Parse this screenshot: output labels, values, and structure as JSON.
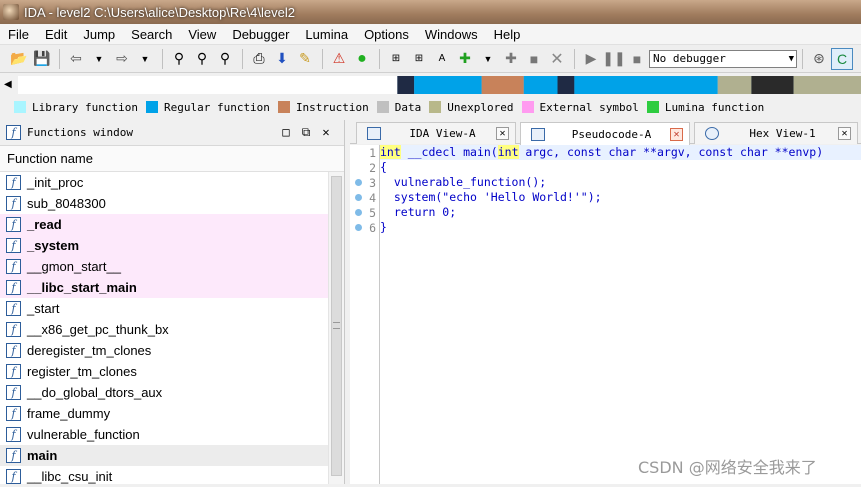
{
  "window": {
    "title": "IDA - level2 C:\\Users\\alice\\Desktop\\Re\\4\\level2"
  },
  "menu": [
    "File",
    "Edit",
    "Jump",
    "Search",
    "View",
    "Debugger",
    "Lumina",
    "Options",
    "Windows",
    "Help"
  ],
  "toolbar": {
    "debugger_select": "No debugger"
  },
  "navbar": {
    "segments": [
      {
        "from": 0.0,
        "to": 0.45,
        "color": "#ffffff"
      },
      {
        "from": 0.45,
        "to": 0.47,
        "color": "#1f2a44"
      },
      {
        "from": 0.47,
        "to": 0.55,
        "color": "#00a2e8"
      },
      {
        "from": 0.55,
        "to": 0.6,
        "color": "#c8825a"
      },
      {
        "from": 0.6,
        "to": 0.64,
        "color": "#00a2e8"
      },
      {
        "from": 0.64,
        "to": 0.66,
        "color": "#1f2a44"
      },
      {
        "from": 0.66,
        "to": 0.83,
        "color": "#00a2e8"
      },
      {
        "from": 0.83,
        "to": 0.87,
        "color": "#b0b090"
      },
      {
        "from": 0.87,
        "to": 0.92,
        "color": "#2a2a2a"
      },
      {
        "from": 0.92,
        "to": 1.0,
        "color": "#b0b090"
      }
    ]
  },
  "legend": [
    {
      "label": "Library function",
      "color": "#a9f5ff"
    },
    {
      "label": "Regular function",
      "color": "#00a2e8"
    },
    {
      "label": "Instruction",
      "color": "#c8825a"
    },
    {
      "label": "Data",
      "color": "#c0c0c0"
    },
    {
      "label": "Unexplored",
      "color": "#b8b88a"
    },
    {
      "label": "External symbol",
      "color": "#ff9bf0"
    },
    {
      "label": "Lumina function",
      "color": "#2ecc40"
    }
  ],
  "functions_window": {
    "title": "Functions window",
    "column": "Function name",
    "items": [
      {
        "name": "_init_proc",
        "style": ""
      },
      {
        "name": "sub_8048300",
        "style": ""
      },
      {
        "name": "_read",
        "style": "pink bold"
      },
      {
        "name": "_system",
        "style": "pink bold"
      },
      {
        "name": "__gmon_start__",
        "style": "pink"
      },
      {
        "name": "__libc_start_main",
        "style": "pink bold"
      },
      {
        "name": "_start",
        "style": ""
      },
      {
        "name": "__x86_get_pc_thunk_bx",
        "style": ""
      },
      {
        "name": "deregister_tm_clones",
        "style": ""
      },
      {
        "name": "register_tm_clones",
        "style": ""
      },
      {
        "name": "__do_global_dtors_aux",
        "style": ""
      },
      {
        "name": "frame_dummy",
        "style": ""
      },
      {
        "name": "vulnerable_function",
        "style": ""
      },
      {
        "name": "main",
        "style": "sel bold"
      },
      {
        "name": "__libc_csu_init",
        "style": ""
      }
    ]
  },
  "tabs": [
    {
      "label": "IDA View-A",
      "active": false
    },
    {
      "label": "Pseudocode-A",
      "active": true
    },
    {
      "label": "Hex View-1",
      "active": false
    }
  ],
  "code": {
    "lines": [
      {
        "no": "1",
        "dot": false,
        "text": "int __cdecl main(int argc, const char **argv, const char **envp)"
      },
      {
        "no": "2",
        "dot": false,
        "text": "{"
      },
      {
        "no": "3",
        "dot": true,
        "text": "  vulnerable_function();"
      },
      {
        "no": "4",
        "dot": true,
        "text": "  system(\"echo 'Hello World!'\");"
      },
      {
        "no": "5",
        "dot": true,
        "text": "  return 0;"
      },
      {
        "no": "6",
        "dot": true,
        "text": "}"
      }
    ]
  },
  "watermark": "CSDN @网络安全我来了"
}
